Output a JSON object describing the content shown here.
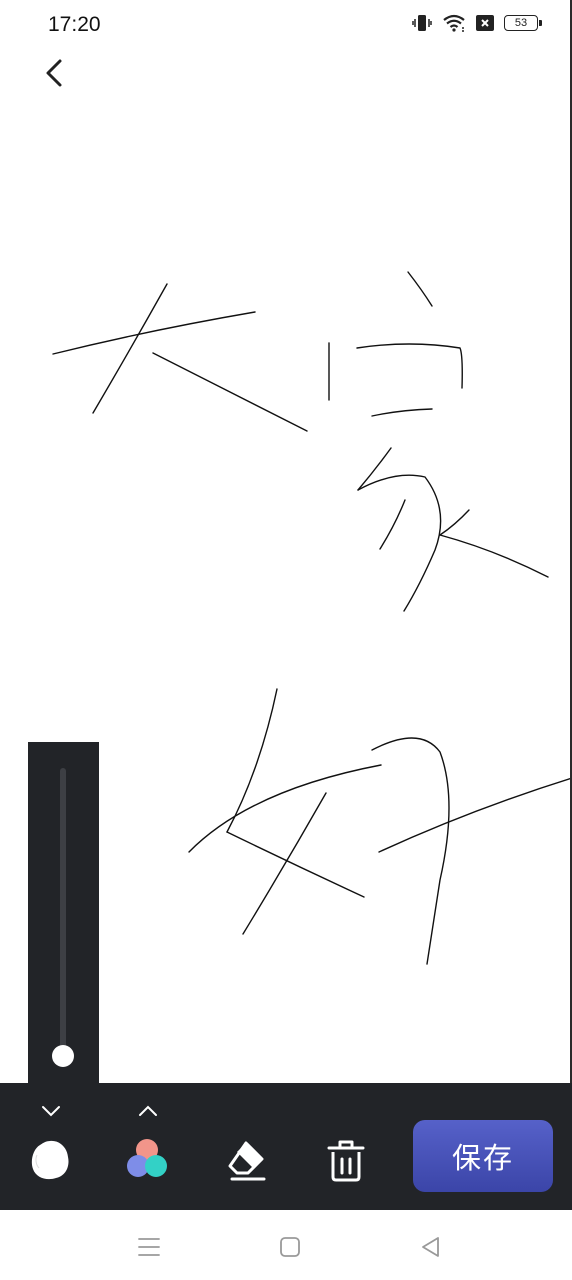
{
  "status_bar": {
    "time": "17:20",
    "icons": [
      "vibrate-icon",
      "wifi-icon",
      "x-box-icon",
      "battery-icon"
    ],
    "battery_level": "53"
  },
  "header": {
    "back_icon": "chevron-left-icon"
  },
  "canvas": {
    "stroke_color": "#111111",
    "background": "#ffffff"
  },
  "size_slider": {
    "value": 0.0
  },
  "toolbar": {
    "brush_icon": "brush-blob-icon",
    "palette_icon": "color-palette-icon",
    "eraser_icon": "eraser-icon",
    "delete_icon": "trash-icon",
    "save_label": "保存",
    "save_color": "#4550b8",
    "panel_color": "#222428"
  },
  "nav_bar": {
    "icons": [
      "menu-icon",
      "home-icon",
      "back-triangle-icon"
    ]
  }
}
